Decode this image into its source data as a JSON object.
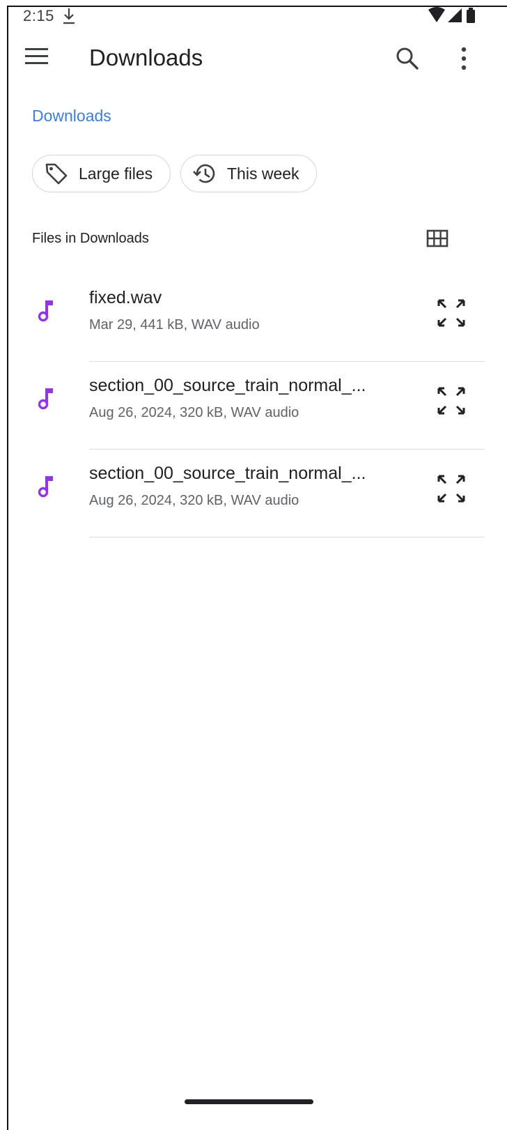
{
  "status_bar": {
    "time": "2:15"
  },
  "app_bar": {
    "title": "Downloads"
  },
  "breadcrumb": {
    "label": "Downloads"
  },
  "chips": [
    {
      "label": "Large files",
      "icon": "tag-icon"
    },
    {
      "label": "This week",
      "icon": "history-icon"
    }
  ],
  "section": {
    "label": "Files in Downloads"
  },
  "files": [
    {
      "name": "fixed.wav",
      "meta": "Mar 29, 441 kB, WAV audio",
      "icon": "music-note-icon"
    },
    {
      "name": "section_00_source_train_normal_...",
      "meta": "Aug 26, 2024, 320 kB, WAV audio",
      "icon": "music-note-icon"
    },
    {
      "name": "section_00_source_train_normal_...",
      "meta": "Aug 26, 2024, 320 kB, WAV audio",
      "icon": "music-note-icon"
    }
  ],
  "colors": {
    "accent": "#3f7ed8",
    "audio_icon": "#9334e6",
    "text": "#202124",
    "secondary_text": "#5f6368"
  }
}
